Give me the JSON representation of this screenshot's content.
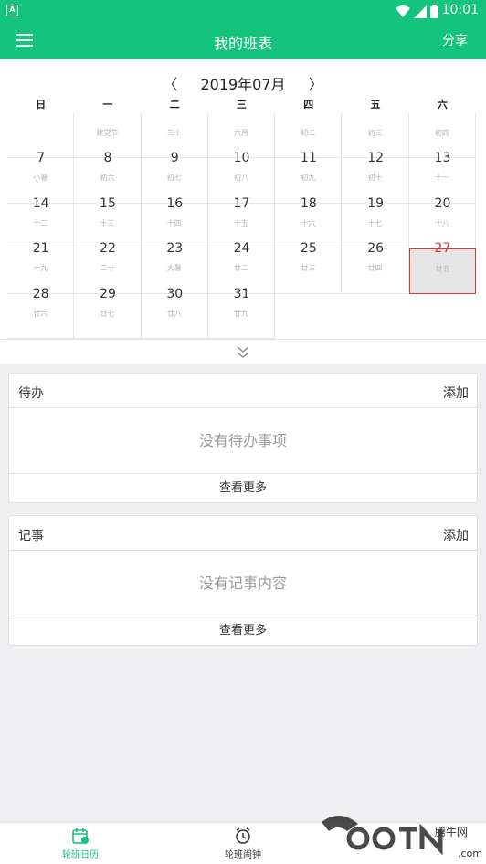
{
  "status_bar": {
    "app_badge": "A",
    "time": "10:01",
    "battery": "2"
  },
  "app_bar": {
    "title": "我的班表",
    "share_label": "分享"
  },
  "calendar": {
    "prev_arrow": "〈",
    "next_arrow": "〉",
    "month_label": "2019年07月",
    "weekdays": [
      "日",
      "一",
      "二",
      "三",
      "四",
      "五",
      "六"
    ],
    "rows": [
      [
        {
          "d": "",
          "l": ""
        },
        {
          "d": "",
          "l": "建党节"
        },
        {
          "d": "",
          "l": "三十"
        },
        {
          "d": "",
          "l": "六月"
        },
        {
          "d": "",
          "l": "初二"
        },
        {
          "d": "",
          "l": "初三"
        },
        {
          "d": "",
          "l": "初四"
        }
      ],
      [
        {
          "d": "7",
          "l": "小暑"
        },
        {
          "d": "8",
          "l": "初六"
        },
        {
          "d": "9",
          "l": "初七"
        },
        {
          "d": "10",
          "l": "初八"
        },
        {
          "d": "11",
          "l": "初九"
        },
        {
          "d": "12",
          "l": "初十"
        },
        {
          "d": "13",
          "l": "十一"
        }
      ],
      [
        {
          "d": "14",
          "l": "十二"
        },
        {
          "d": "15",
          "l": "十三"
        },
        {
          "d": "16",
          "l": "十四"
        },
        {
          "d": "17",
          "l": "十五"
        },
        {
          "d": "18",
          "l": "十六"
        },
        {
          "d": "19",
          "l": "十七"
        },
        {
          "d": "20",
          "l": "十八"
        }
      ],
      [
        {
          "d": "21",
          "l": "十九"
        },
        {
          "d": "22",
          "l": "二十"
        },
        {
          "d": "23",
          "l": "大暑"
        },
        {
          "d": "24",
          "l": "廿二"
        },
        {
          "d": "25",
          "l": "廿三"
        },
        {
          "d": "26",
          "l": "廿四"
        },
        {
          "d": "27",
          "l": "廿五",
          "red": true,
          "today": true
        }
      ],
      [
        {
          "d": "28",
          "l": "廿六"
        },
        {
          "d": "29",
          "l": "廿七"
        },
        {
          "d": "30",
          "l": "廿八"
        },
        {
          "d": "31",
          "l": "廿九"
        },
        null,
        null,
        null
      ]
    ]
  },
  "todo": {
    "title": "待办",
    "add_label": "添加",
    "empty_text": "没有待办事项",
    "more_label": "查看更多"
  },
  "notes": {
    "title": "记事",
    "add_label": "添加",
    "empty_text": "没有记事内容",
    "more_label": "查看更多"
  },
  "tabbar": {
    "tabs": [
      {
        "label": "轮班日历",
        "icon": "calendar-icon",
        "active": true
      },
      {
        "label": "轮班闹钟",
        "icon": "alarm-clock-icon",
        "active": false
      }
    ]
  },
  "colors": {
    "brand": "#14c37c",
    "today_border": "#d43a3a",
    "weekend_red": "#e23030"
  },
  "watermark": {
    "text": "腾牛网",
    "domain": ".com"
  }
}
